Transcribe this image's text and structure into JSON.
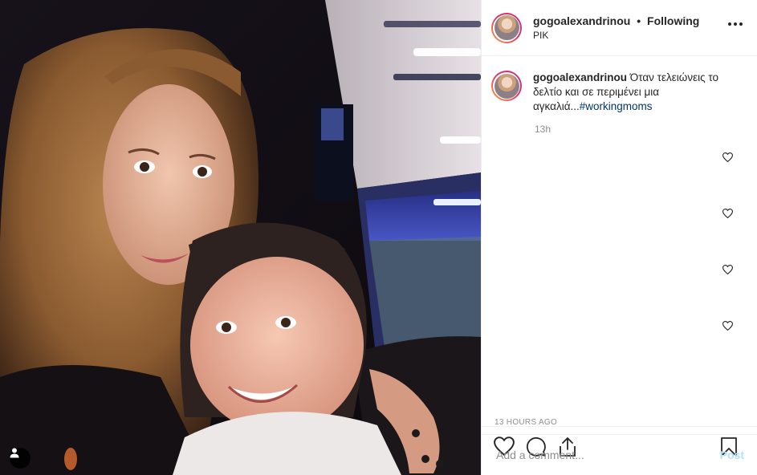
{
  "post": {
    "username": "gogoalexandrinou",
    "following_label": "Following",
    "separator": "•",
    "location": "PIK",
    "caption_username": "gogoalexandrinou",
    "caption_text": "Όταν τελειώνεις το δελτίο και σε περιμένει μια αγκαλιά...",
    "caption_hashtag": "#workingmoms",
    "caption_time": "13h",
    "posted_ago": "13 HOURS AGO"
  },
  "comment_box": {
    "placeholder": "Add a comment...",
    "post_label": "Post"
  },
  "icons": {
    "more": "more-options-icon",
    "like": "heart-icon",
    "comment": "comment-icon",
    "share": "share-icon",
    "save": "bookmark-icon",
    "tag": "user-tag-icon"
  },
  "colors": {
    "text": "#262626",
    "muted": "#8e8e8e",
    "hashtag": "#00376b",
    "post_button_disabled": "#b2dffc",
    "border": "#efefef"
  }
}
